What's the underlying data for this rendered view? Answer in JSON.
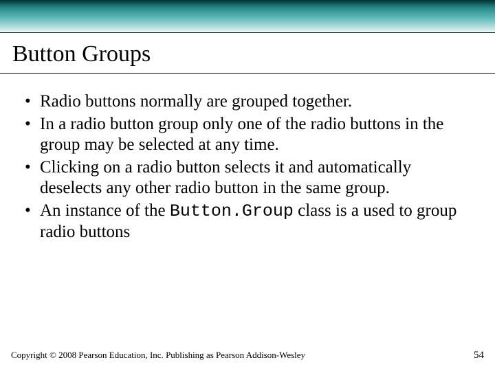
{
  "slide": {
    "title": "Button Groups",
    "bullets": [
      {
        "text": "Radio buttons normally are grouped together."
      },
      {
        "text": "In a radio button group only one of the radio buttons in the group may be selected at any time."
      },
      {
        "text": "Clicking on a radio button selects it and automatically deselects any other radio button in the same group."
      },
      {
        "prefix": "An instance of the ",
        "code": "Button.Group",
        "suffix": " class is a used to group radio buttons"
      }
    ]
  },
  "footer": {
    "copyright": "Copyright © 2008 Pearson Education, Inc. Publishing as Pearson Addison-Wesley",
    "page": "54"
  }
}
